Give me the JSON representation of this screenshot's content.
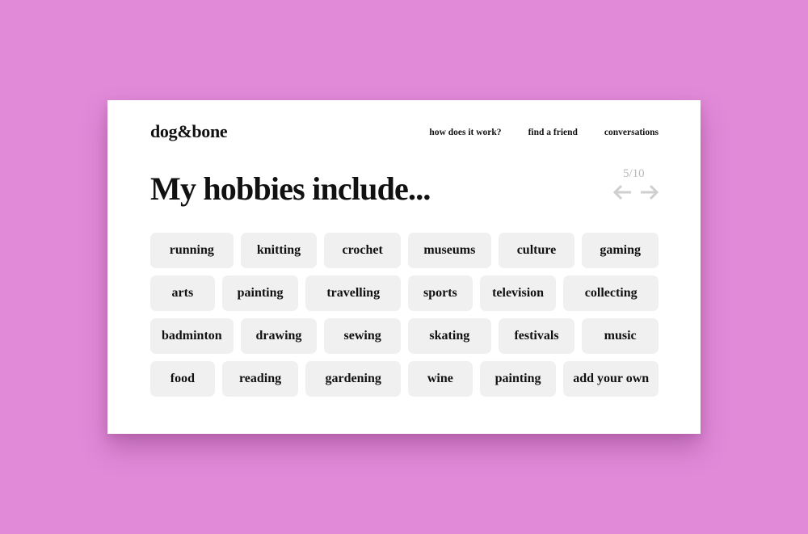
{
  "brand": {
    "logo": "dog&bone"
  },
  "nav": {
    "items": [
      "how does it work?",
      "find a friend",
      "conversations"
    ]
  },
  "page": {
    "headline": "My hobbies include...",
    "progress": "5/10"
  },
  "hobbies": {
    "rows": [
      [
        "running",
        "knitting",
        "crochet",
        "museums",
        "culture",
        "gaming"
      ],
      [
        "arts",
        "painting",
        "travelling",
        "sports",
        "television",
        "collecting"
      ],
      [
        "badminton",
        "drawing",
        "sewing",
        "skating",
        "festivals",
        "music"
      ],
      [
        "food",
        "reading",
        "gardening",
        "wine",
        "painting",
        "add your own"
      ]
    ]
  },
  "colors": {
    "background": "#e08ad8",
    "card": "#ffffff",
    "chip": "#f0f0f0",
    "text": "#111111",
    "muted": "#b9b9b9"
  },
  "icons": {
    "previous": "arrow-left-icon",
    "next": "arrow-right-icon"
  }
}
